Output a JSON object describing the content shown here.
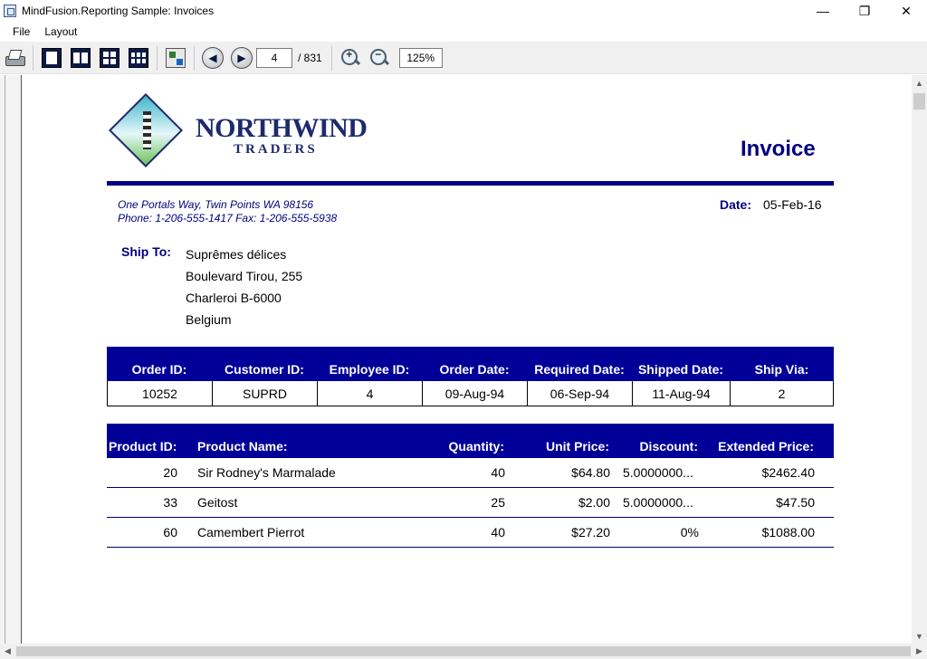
{
  "window": {
    "title": "MindFusion.Reporting Sample: Invoices",
    "controls": {
      "minimize": "—",
      "maximize": "❐",
      "close": "✕"
    }
  },
  "menu": [
    {
      "label": "File"
    },
    {
      "label": "Layout"
    }
  ],
  "toolbar": {
    "page_current": "4",
    "page_total": "/ 831",
    "zoom_in_glyph": "+",
    "zoom_out_glyph": "−",
    "zoom_level": "125%",
    "prev_glyph": "◀",
    "next_glyph": "▶"
  },
  "invoice": {
    "logo_top": "NORTHWIND",
    "logo_bottom": "TRADERS",
    "title": "Invoice",
    "company_address_line1": "One Portals Way, Twin Points WA  98156",
    "company_address_line2": "Phone: 1-206-555-1417   Fax: 1-206-555-5938",
    "date_label": "Date:",
    "date_value": "05-Feb-16",
    "ship_to_label": "Ship To:",
    "ship_to": {
      "name": "Suprêmes délices",
      "street": "Boulevard Tirou, 255",
      "city": "Charleroi  B-6000",
      "country": "Belgium"
    },
    "order_columns": [
      "Order ID:",
      "Customer ID:",
      "Employee ID:",
      "Order Date:",
      "Required Date:",
      "Shipped Date:",
      "Ship Via:"
    ],
    "order_values": [
      "10252",
      "SUPRD",
      "4",
      "09-Aug-94",
      "06-Sep-94",
      "11-Aug-94",
      "2"
    ],
    "product_columns": [
      "Product ID:",
      "Product Name:",
      "Quantity:",
      "Unit Price:",
      "Discount:",
      "Extended Price:"
    ],
    "products": [
      {
        "id": "20",
        "name": "Sir Rodney's Marmalade",
        "qty": "40",
        "price": "$64.80",
        "discount": "5.0000000...",
        "extended": "$2462.40"
      },
      {
        "id": "33",
        "name": "Geitost",
        "qty": "25",
        "price": "$2.00",
        "discount": "5.0000000...",
        "extended": "$47.50"
      },
      {
        "id": "60",
        "name": "Camembert Pierrot",
        "qty": "40",
        "price": "$27.20",
        "discount": "0%",
        "extended": "$1088.00"
      }
    ]
  },
  "colors": {
    "header_navy": "#000099",
    "accent_navy": "#000080"
  }
}
